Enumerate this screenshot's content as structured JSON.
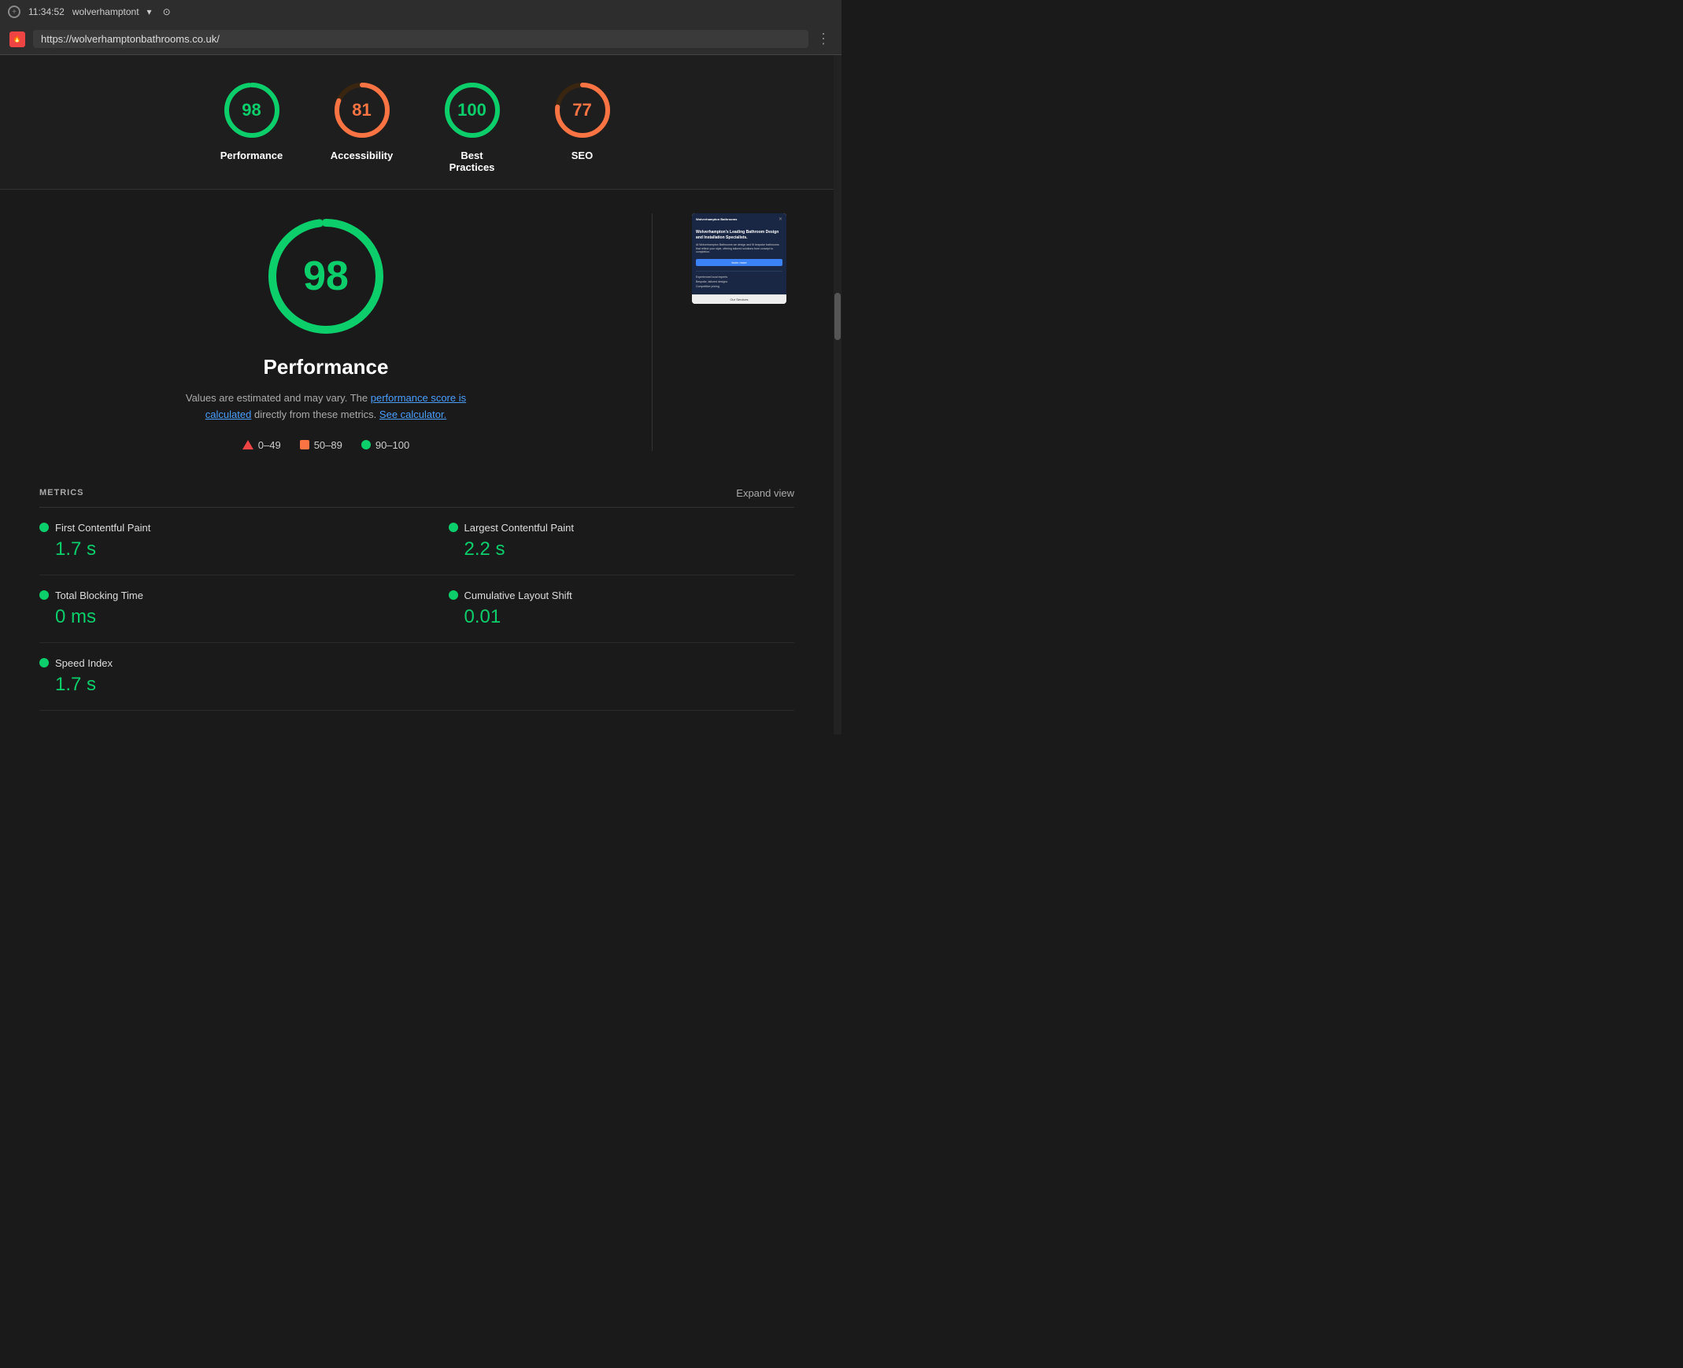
{
  "titlebar": {
    "time": "11:34:52",
    "title": "wolverhamptont",
    "stop_icon": "⊙"
  },
  "browserbar": {
    "url": "https://wolverhamptonbathrooms.co.uk/",
    "menu_icon": "⋮"
  },
  "scores": [
    {
      "id": "performance",
      "value": 98,
      "label": "Performance",
      "color": "#0cce6b",
      "track_color": "#1a3a2a",
      "percentage": 98
    },
    {
      "id": "accessibility",
      "value": 81,
      "label": "Accessibility",
      "color": "#fa7343",
      "track_color": "#3a2510",
      "percentage": 81
    },
    {
      "id": "best-practices",
      "value": 100,
      "label": "Best Practices",
      "color": "#0cce6b",
      "track_color": "#1a3a2a",
      "percentage": 100
    },
    {
      "id": "seo",
      "value": 77,
      "label": "SEO",
      "color": "#fa7343",
      "track_color": "#3a2510",
      "percentage": 77
    }
  ],
  "detail": {
    "score": 98,
    "title": "Performance",
    "description": "Values are estimated and may vary. The",
    "link1_text": "performance score is calculated",
    "link1_between": "directly from these metrics.",
    "link2_text": "See calculator.",
    "legend": [
      {
        "id": "low",
        "range": "0–49",
        "type": "triangle"
      },
      {
        "id": "medium",
        "range": "50–89",
        "type": "square"
      },
      {
        "id": "high",
        "range": "90–100",
        "type": "circle"
      }
    ]
  },
  "preview": {
    "headline": "Wolverhampton's Leading Bathroom Design and Installation Specialists.",
    "body_text": "At Wolverhampton Bathrooms we design and fit bespoke bathrooms that reflect your style, offering tailored solutions from concept to completion.",
    "button_text": "learn more",
    "features": [
      "Experienced local experts",
      "Bespoke, tailored designs",
      "Competitive pricing"
    ],
    "footer_text": "Our Services"
  },
  "metrics": {
    "header": "METRICS",
    "expand": "Expand view",
    "items": [
      {
        "id": "fcp",
        "name": "First Contentful Paint",
        "value": "1.7 s",
        "color": "#0cce6b"
      },
      {
        "id": "lcp",
        "name": "Largest Contentful Paint",
        "value": "2.2 s",
        "color": "#0cce6b"
      },
      {
        "id": "tbt",
        "name": "Total Blocking Time",
        "value": "0 ms",
        "color": "#0cce6b"
      },
      {
        "id": "cls",
        "name": "Cumulative Layout Shift",
        "value": "0.01",
        "color": "#0cce6b"
      },
      {
        "id": "si",
        "name": "Speed Index",
        "value": "1.7 s",
        "color": "#0cce6b"
      }
    ]
  }
}
